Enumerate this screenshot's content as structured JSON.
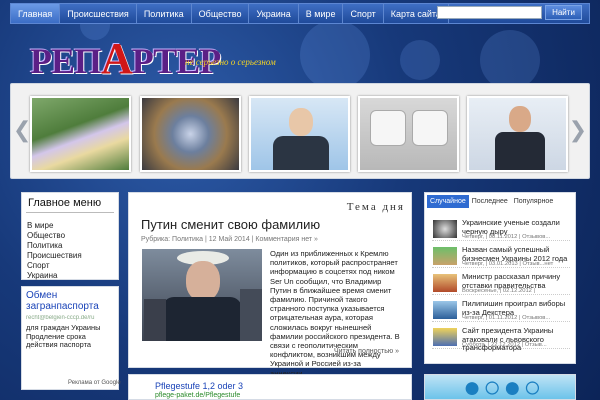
{
  "nav": {
    "items": [
      "Главная",
      "Происшествия",
      "Политика",
      "Общество",
      "Украина",
      "В мире",
      "Спорт",
      "Карта сайта"
    ],
    "search_button": "Найти"
  },
  "logo": {
    "pre": "РЕП",
    "mid": "А",
    "post": "РТЕР",
    "slogan": "не серьезно о серьезном"
  },
  "sidebar": {
    "title": "Главное меню",
    "items": [
      "В мире",
      "Общество",
      "Политика",
      "Происшествия",
      "Спорт",
      "Украина"
    ]
  },
  "ad_left": {
    "title": "Обмен загранпаспорта",
    "url": "recht@belgien-cccp.de/ru",
    "text": "для граждан Украины Продление срока действия паспорта",
    "label": "Реклама от Google"
  },
  "post": {
    "tag_head": "Тема дня",
    "title": "Путин сменит свою фамилию",
    "meta": "Рубрика: Политика | 12 Май 2014 | Комментария нет »",
    "text": "Один из приближенных к Кремлю политиков, который распространяет информацию в соцсетях под ником Ser Un сообщил, что Владимир Путин в ближайшее время сменит фамилию. Причиной такого странного поступка указывается отрицательная аура, которая сложилась вокруг нынешней фамилии российского президента. В связи с геополитическим конфликтом, возникшим между Украиной и Россией из-за аннексии…",
    "more": "Читать полностью »"
  },
  "ad_center": {
    "title": "Pflegestufe 1,2 oder 3",
    "url": "pflege-paket.de/Pflegestufe"
  },
  "tabs": [
    "Случайное",
    "Последнее",
    "Популярное"
  ],
  "news": [
    {
      "title": "Украинские ученые создали черную дыру",
      "meta": "Четверг, | 08.11.2012 | Отзывов..."
    },
    {
      "title": "Назван самый успешный бизнесмен Украины 2012 года",
      "meta": "Четверг, | 03.01.2013 | Отзыв...нет"
    },
    {
      "title": "Министр рассказал причину отставки правительства",
      "meta": "Воскресенье, | 02.12.2012 |"
    },
    {
      "title": "Пилипишин проиграл виборы из-за Декстера",
      "meta": "Четверг, | 01.11.2012 | Отзывов..."
    },
    {
      "title": "Сайт президента Украины атаковали с львовского трансформатора",
      "meta": "Суббота, | 22.12.2012 | Отзыв..."
    }
  ],
  "colors": {
    "accent": "#2f6bd1",
    "logo_purple": "#5b1f86",
    "logo_red": "#d11717",
    "slogan": "#f2d226"
  }
}
